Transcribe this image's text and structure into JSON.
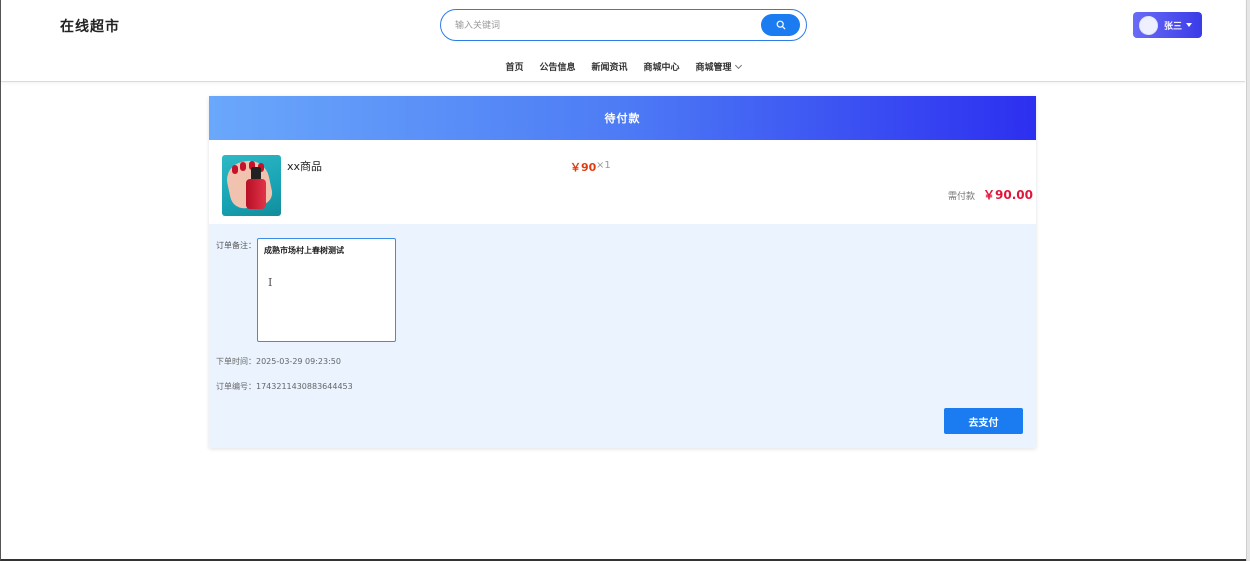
{
  "header": {
    "logo": "在线超市",
    "search": {
      "placeholder": "输入关键词",
      "value": ""
    },
    "user": {
      "name": "张三"
    }
  },
  "nav": {
    "items": [
      {
        "label": "首页"
      },
      {
        "label": "公告信息"
      },
      {
        "label": "新闻资讯"
      },
      {
        "label": "商城中心"
      },
      {
        "label": "商城管理"
      }
    ]
  },
  "order": {
    "status_title": "待付款",
    "product": {
      "name": "xx商品",
      "price": "￥90",
      "quantity": "×1"
    },
    "total_label": "需付款",
    "total_value": "￥90.00",
    "remark_label": "订单备注：",
    "remark_value": "成熟市场村上春树测试",
    "time_label": "下单时间：",
    "time_value": "2025-03-29 09:23:50",
    "no_label": "订单编号：",
    "no_value": "1743211430883644453",
    "pay_label": "去支付"
  },
  "colors": {
    "accent": "#1a7cf0",
    "header_gradient_start": "#6aa8fb",
    "header_gradient_end": "#2d2ff0",
    "price": "#e23c13",
    "total": "#e2163c",
    "card_bg": "#eaf3fe"
  }
}
